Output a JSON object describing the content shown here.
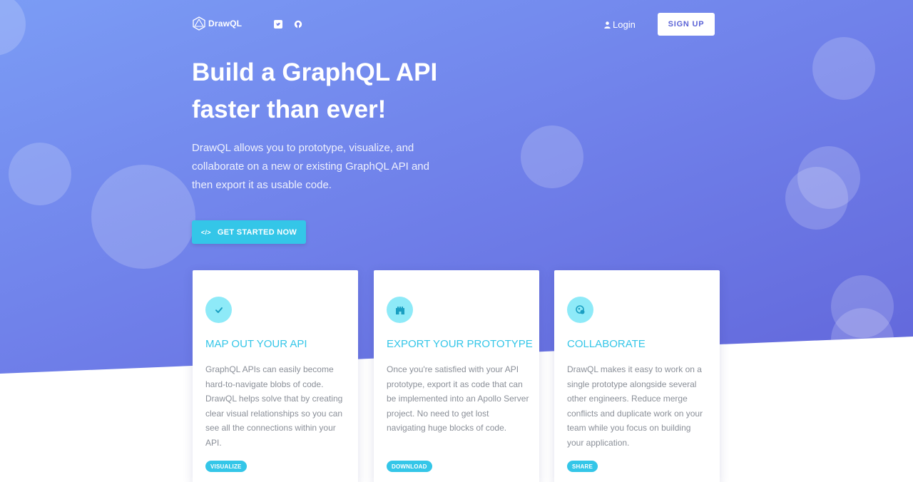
{
  "nav": {
    "logo_text": "DrawQL",
    "login_label": "Login",
    "signup_label": "SIGN UP",
    "icons": [
      "logo-mark-icon",
      "twitter-icon",
      "github-icon",
      "user-icon"
    ]
  },
  "hero": {
    "headline_line1": "Build a GraphQL API",
    "headline_line2": "faster than ever!",
    "subtitle": "DrawQL allows you to prototype, visualize, and collaborate on a new or existing GraphQL API and then export it as usable code.",
    "cta_label": "GET STARTED NOW",
    "cta_icon": "code-icon"
  },
  "features": [
    {
      "icon": "check-icon",
      "title": "MAP OUT YOUR API",
      "text": "GraphQL APIs can easily become hard-to-navigate blobs of code. DrawQL helps solve that by creating clear visual relationships so you can see all the connections within your API.",
      "tag": "VISUALIZE"
    },
    {
      "icon": "castle-icon",
      "title": "EXPORT YOUR PROTOTYPE",
      "text": "Once you're satisfied with your API prototype, export it as code that can be implemented into an Apollo Server project. No need to get lost navigating huge blocks of code.",
      "tag": "DOWNLOAD"
    },
    {
      "icon": "collaborate-icon",
      "title": "COLLABORATE",
      "text": "DrawQL makes it easy to work on a single prototype alongside several other engineers. Reduce merge conflicts and duplicate work on your team while you focus on building your application.",
      "tag": "SHARE"
    }
  ],
  "colors": {
    "gradient_start": "#7b9cf5",
    "gradient_end": "#5e5fd6",
    "accent": "#34c6e8",
    "icon_bg": "#8eeaf8",
    "body_text": "#8a8f98",
    "signup_text": "#5b63d6"
  }
}
